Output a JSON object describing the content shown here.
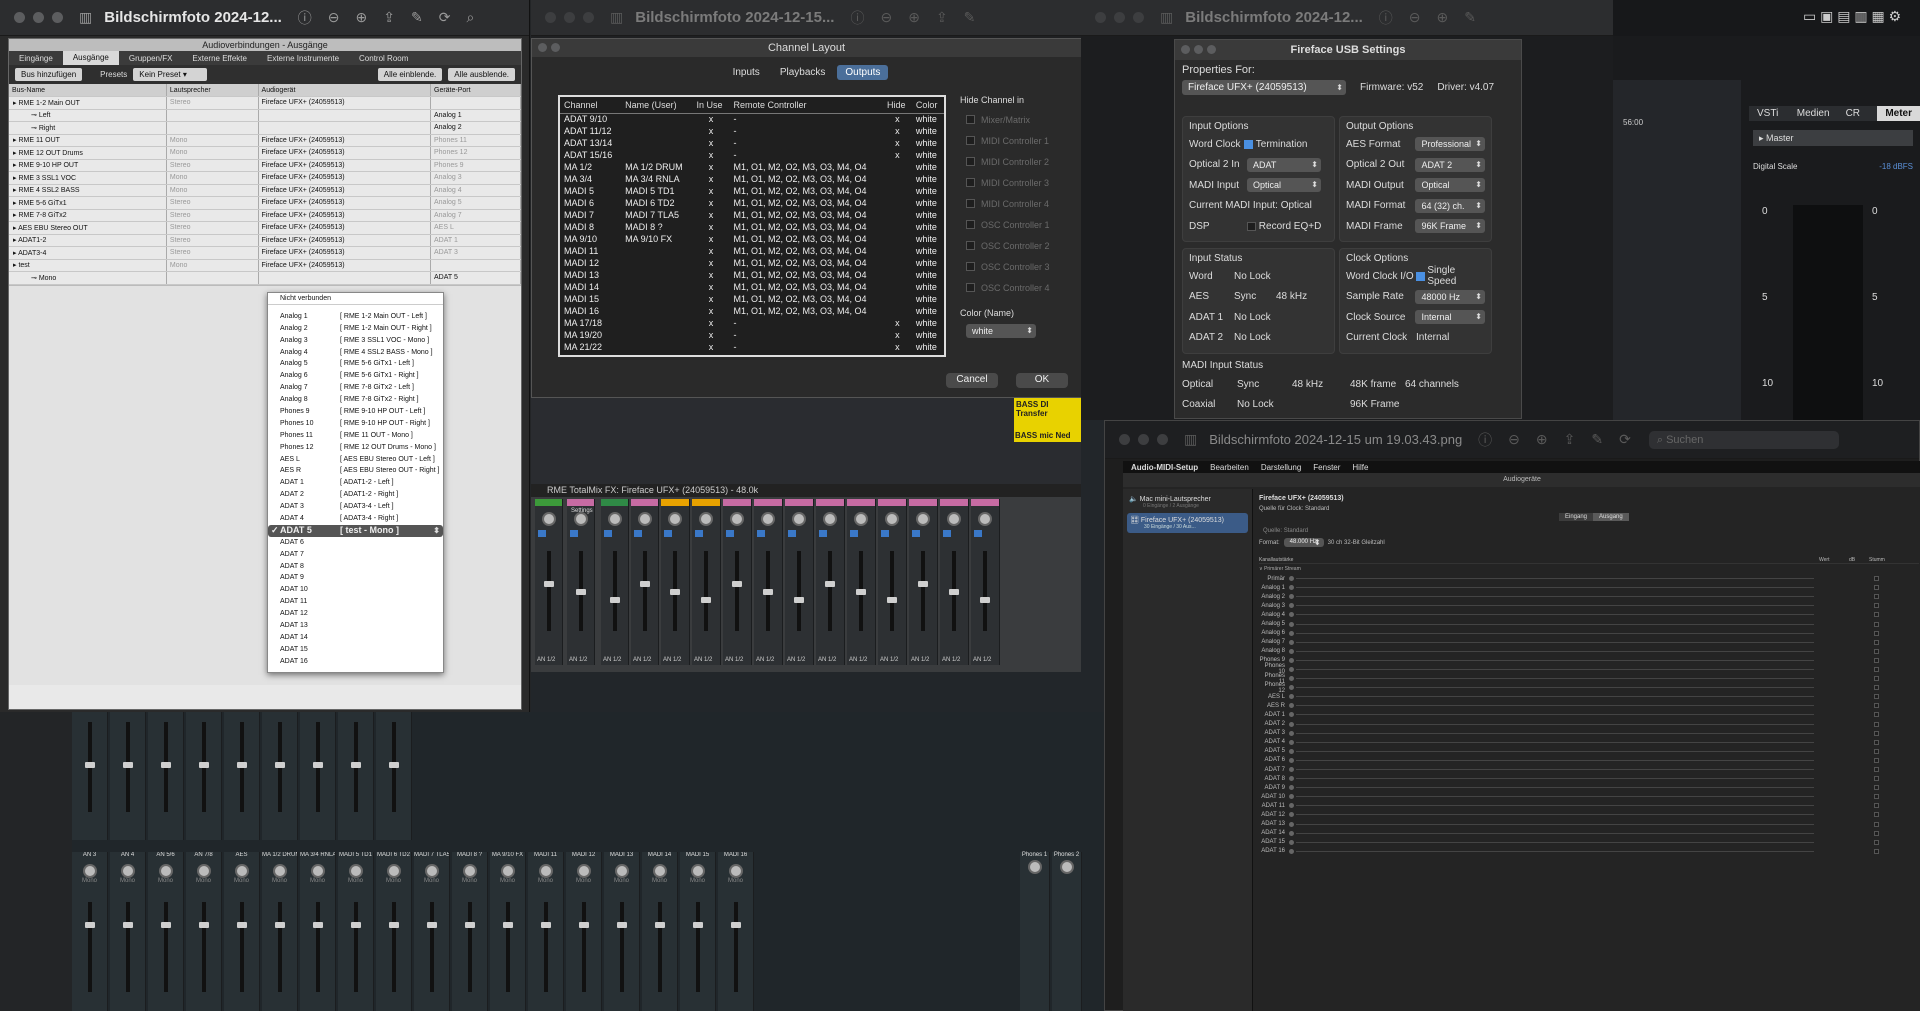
{
  "win1": {
    "title": "Bildschirmfoto 2024-12..."
  },
  "win2": {
    "title": "Bildschirmfoto 2024-12-15..."
  },
  "win3": {
    "title": "Bildschirmfoto 2024-12..."
  },
  "cubase": {
    "title": "Audioverbindungen - Ausgänge",
    "tabs": [
      "Eingänge",
      "Ausgänge",
      "Gruppen/FX",
      "Externe Effekte",
      "Externe Instrumente",
      "Control Room"
    ],
    "add_bus": "Bus hinzufügen",
    "presets_label": "Presets",
    "preset_value": "Kein Preset",
    "show_all": "Alle einblende.",
    "hide_all": "Alle ausblende.",
    "columns": [
      "Bus-Name",
      "Lautsprecher",
      "Audiogerät",
      "Geräte-Port"
    ],
    "rows": [
      {
        "name": "RME 1-2 Main OUT",
        "spk": "Stereo",
        "dev": "Fireface UFX+ (24059513)",
        "port": ""
      },
      {
        "name": "Left",
        "spk": "",
        "dev": "",
        "port": "Analog 1"
      },
      {
        "name": "Right",
        "spk": "",
        "dev": "",
        "port": "Analog 2"
      },
      {
        "name": "RME 11 OUT",
        "spk": "Mono",
        "dev": "Fireface UFX+ (24059513)",
        "port": "Phones 11"
      },
      {
        "name": "RME 12 OUT Drums",
        "spk": "Mono",
        "dev": "Fireface UFX+ (24059513)",
        "port": "Phones 12"
      },
      {
        "name": "RME 9-10 HP OUT",
        "spk": "Stereo",
        "dev": "Fireface UFX+ (24059513)",
        "port": "Phones 9"
      },
      {
        "name": "RME 3 SSL1 VOC",
        "spk": "Mono",
        "dev": "Fireface UFX+ (24059513)",
        "port": "Analog 3"
      },
      {
        "name": "RME 4 SSL2 BASS",
        "spk": "Mono",
        "dev": "Fireface UFX+ (24059513)",
        "port": "Analog 4"
      },
      {
        "name": "RME 5-6 GiTx1",
        "spk": "Stereo",
        "dev": "Fireface UFX+ (24059513)",
        "port": "Analog 5"
      },
      {
        "name": "RME 7-8 GiTx2",
        "spk": "Stereo",
        "dev": "Fireface UFX+ (24059513)",
        "port": "Analog 7"
      },
      {
        "name": "AES EBU Stereo OUT",
        "spk": "Stereo",
        "dev": "Fireface UFX+ (24059513)",
        "port": "AES L"
      },
      {
        "name": "ADAT1-2",
        "spk": "Stereo",
        "dev": "Fireface UFX+ (24059513)",
        "port": "ADAT 1"
      },
      {
        "name": "ADAT3-4",
        "spk": "Stereo",
        "dev": "Fireface UFX+ (24059513)",
        "port": "ADAT 3"
      },
      {
        "name": "test",
        "spk": "Mono",
        "dev": "Fireface UFX+ (24059513)",
        "port": ""
      },
      {
        "name": "Mono",
        "spk": "",
        "dev": "",
        "port": "ADAT 5"
      }
    ],
    "dropdown": {
      "not_connected": "Nicht verbunden",
      "items": [
        [
          "Analog 1",
          "[ RME 1-2 Main OUT - Left ]"
        ],
        [
          "Analog 2",
          "[ RME 1-2 Main OUT - Right ]"
        ],
        [
          "Analog 3",
          "[ RME 3 SSL1 VOC - Mono ]"
        ],
        [
          "Analog 4",
          "[ RME 4 SSL2 BASS - Mono ]"
        ],
        [
          "Analog 5",
          "[ RME 5-6 GiTx1 - Left ]"
        ],
        [
          "Analog 6",
          "[ RME 5-6 GiTx1 - Right ]"
        ],
        [
          "Analog 7",
          "[ RME 7-8 GiTx2 - Left ]"
        ],
        [
          "Analog 8",
          "[ RME 7-8 GiTx2 - Right ]"
        ],
        [
          "Phones 9",
          "[ RME 9-10 HP OUT - Left ]"
        ],
        [
          "Phones 10",
          "[ RME 9-10 HP OUT - Right ]"
        ],
        [
          "Phones 11",
          "[ RME 11 OUT - Mono ]"
        ],
        [
          "Phones 12",
          "[ RME 12 OUT Drums - Mono ]"
        ],
        [
          "AES L",
          "[ AES EBU Stereo OUT - Left ]"
        ],
        [
          "AES R",
          "[ AES EBU Stereo OUT - Right ]"
        ],
        [
          "ADAT 1",
          "[ ADAT1-2 - Left ]"
        ],
        [
          "ADAT 2",
          "[ ADAT1-2 - Right ]"
        ],
        [
          "ADAT 3",
          "[ ADAT3-4 - Left ]"
        ],
        [
          "ADAT 4",
          "[ ADAT3-4 - Right ]"
        ],
        [
          "ADAT 5",
          "[ test - Mono ]"
        ],
        [
          "ADAT 6",
          ""
        ],
        [
          "ADAT 7",
          ""
        ],
        [
          "ADAT 8",
          ""
        ],
        [
          "ADAT 9",
          ""
        ],
        [
          "ADAT 10",
          ""
        ],
        [
          "ADAT 11",
          ""
        ],
        [
          "ADAT 12",
          ""
        ],
        [
          "ADAT 13",
          ""
        ],
        [
          "ADAT 14",
          ""
        ],
        [
          "ADAT 15",
          ""
        ],
        [
          "ADAT 16",
          ""
        ]
      ],
      "selected_index": 18
    }
  },
  "channel_layout": {
    "title": "Channel Layout",
    "tabs": [
      "Inputs",
      "Playbacks",
      "Outputs"
    ],
    "active_tab": 2,
    "columns": [
      "Channel",
      "Name (User)",
      "In Use",
      "Remote Controller",
      "Hide",
      "Color"
    ],
    "rows": [
      [
        "ADAT 9/10",
        "",
        "x",
        "-",
        "x",
        "white"
      ],
      [
        "ADAT 11/12",
        "",
        "x",
        "-",
        "x",
        "white"
      ],
      [
        "ADAT 13/14",
        "",
        "x",
        "-",
        "x",
        "white"
      ],
      [
        "ADAT 15/16",
        "",
        "x",
        "-",
        "x",
        "white"
      ],
      [
        "MA 1/2",
        "MA 1/2 DRUM",
        "x",
        "M1, O1, M2, O2, M3, O3, M4, O4",
        "",
        "white"
      ],
      [
        "MA 3/4",
        "MA 3/4 RNLA",
        "x",
        "M1, O1, M2, O2, M3, O3, M4, O4",
        "",
        "white"
      ],
      [
        "MADI 5",
        "MADI 5 TD1",
        "x",
        "M1, O1, M2, O2, M3, O3, M4, O4",
        "",
        "white"
      ],
      [
        "MADI 6",
        "MADI 6 TD2",
        "x",
        "M1, O1, M2, O2, M3, O3, M4, O4",
        "",
        "white"
      ],
      [
        "MADI 7",
        "MADI 7 TLA5",
        "x",
        "M1, O1, M2, O2, M3, O3, M4, O4",
        "",
        "white"
      ],
      [
        "MADI 8",
        "MADI 8 ?",
        "x",
        "M1, O1, M2, O2, M3, O3, M4, O4",
        "",
        "white"
      ],
      [
        "MA 9/10",
        "MA 9/10 FX",
        "x",
        "M1, O1, M2, O2, M3, O3, M4, O4",
        "",
        "white"
      ],
      [
        "MADI 11",
        "",
        "x",
        "M1, O1, M2, O2, M3, O3, M4, O4",
        "",
        "white"
      ],
      [
        "MADI 12",
        "",
        "x",
        "M1, O1, M2, O2, M3, O3, M4, O4",
        "",
        "white"
      ],
      [
        "MADI 13",
        "",
        "x",
        "M1, O1, M2, O2, M3, O3, M4, O4",
        "",
        "white"
      ],
      [
        "MADI 14",
        "",
        "x",
        "M1, O1, M2, O2, M3, O3, M4, O4",
        "",
        "white"
      ],
      [
        "MADI 15",
        "",
        "x",
        "M1, O1, M2, O2, M3, O3, M4, O4",
        "",
        "white"
      ],
      [
        "MADI 16",
        "",
        "x",
        "M1, O1, M2, O2, M3, O3, M4, O4",
        "",
        "white"
      ],
      [
        "MA 17/18",
        "",
        "x",
        "-",
        "x",
        "white"
      ],
      [
        "MA 19/20",
        "",
        "x",
        "-",
        "x",
        "white"
      ],
      [
        "MA 21/22",
        "",
        "x",
        "-",
        "x",
        "white"
      ]
    ],
    "hide_heading": "Hide Channel in",
    "hide_items": [
      "Mixer/Matrix",
      "MIDI Controller 1",
      "MIDI Controller 2",
      "MIDI Controller 3",
      "MIDI Controller 4",
      "OSC Controller 1",
      "OSC Controller 2",
      "OSC Controller 3",
      "OSC Controller 4"
    ],
    "color_label": "Color (Name)",
    "color_value": "white",
    "cancel": "Cancel",
    "ok": "OK"
  },
  "fireface": {
    "title": "Fireface USB Settings",
    "properties_for": "Properties For:",
    "device": "Fireface UFX+ (24059513)",
    "firmware": "Firmware: v52",
    "driver": "Driver: v4.07",
    "input_options": "Input Options",
    "output_options": "Output Options",
    "word_clock": "Word Clock",
    "termination": "Termination",
    "optical2in": "Optical 2 In",
    "optical2in_v": "ADAT",
    "madi_input": "MADI Input",
    "madi_input_v": "Optical",
    "cur_madi": "Current MADI Input:",
    "cur_madi_v": "Optical",
    "dsp": "DSP",
    "record_eqd": "Record EQ+D",
    "aes_format": "AES Format",
    "aes_format_v": "Professional",
    "optical2out": "Optical 2 Out",
    "optical2out_v": "ADAT 2",
    "madi_output": "MADI Output",
    "madi_output_v": "Optical",
    "madi_format": "MADI Format",
    "madi_format_v": "64 (32) ch.",
    "madi_frame": "MADI Frame",
    "madi_frame_v": "96K Frame",
    "input_status": "Input Status",
    "clock_options": "Clock Options",
    "status": [
      [
        "Word",
        "No Lock",
        ""
      ],
      [
        "AES",
        "Sync",
        "48 kHz"
      ],
      [
        "ADAT 1",
        "No Lock",
        ""
      ],
      [
        "ADAT 2",
        "No Lock",
        ""
      ]
    ],
    "wc_io": "Word Clock I/O",
    "single_speed": "Single Speed",
    "sample_rate": "Sample Rate",
    "sample_rate_v": "48000 Hz",
    "clock_source": "Clock Source",
    "clock_source_v": "Internal",
    "current_clock": "Current Clock",
    "current_clock_v": "Internal",
    "madi_status": "MADI Input Status",
    "madi_rows": [
      [
        "Optical",
        "Sync",
        "48 kHz",
        "48K frame",
        "64 channels"
      ],
      [
        "Coaxial",
        "No Lock",
        "",
        "96K Frame",
        ""
      ]
    ]
  },
  "totalmix": {
    "title": "RME TotalMix FX: Fireface UFX+ (24059513) - 48.0k",
    "settings": "Settings",
    "channel_label": "AN 1/2",
    "bottom_names": [
      "AN 3",
      "AN 4",
      "AN 5/6",
      "AN 7/8",
      "AES",
      "MA 1/2 DRUM",
      "MA 3/4 RNLA",
      "MADI 5 TD1",
      "MADI 6 TD2",
      "MADI 7 TLA5",
      "MADI 8 ?",
      "MA 9/10 FX",
      "MADI 11",
      "MADI 12",
      "MADI 13",
      "MADI 14",
      "MADI 15",
      "MADI 16"
    ],
    "phones": [
      "Phones 1",
      "Phones 2"
    ],
    "mono": "Mono",
    "bass_di": "BASS DI Transfer",
    "bass_mic": "BASS mic Ned"
  },
  "cubase_right": {
    "tabs": [
      "VSTi",
      "Medien",
      "CR",
      "Meter"
    ],
    "master": "Master",
    "scale": "Digital Scale",
    "scale_v": "-18 dBFS",
    "ticks": [
      "0",
      "5",
      "10"
    ],
    "time": "56:00"
  },
  "midi": {
    "window_title": "Bildschirmfoto 2024-12-15 um 19.03.43.png",
    "search": "Suchen",
    "menu": [
      "Audio-MIDI-Setup",
      "Bearbeiten",
      "Darstellung",
      "Fenster",
      "Hilfe"
    ],
    "pane_title": "Audiogeräte",
    "dev1": "Mac mini-Lautsprecher",
    "dev1_sub": "0 Eingänge / 2 Ausgänge",
    "dev2": "Fireface UFX+ (24059513)",
    "dev2_sub": "30 Eingänge / 30 Aus...",
    "heading": "Fireface UFX+ (24059513)",
    "clock": "Quelle für Clock:",
    "clock_v": "Standard",
    "tab_in": "Eingang",
    "tab_out": "Ausgang",
    "source": "Quelle:",
    "source_v": "Standard",
    "format": "Format:",
    "format_v": "48.000 Hz",
    "format_bits": "30 ch 32-Bit Gleitzahl",
    "vol": "Kanallautstärke",
    "col_value": "Wert",
    "col_db": "dB",
    "col_mute": "Stumm",
    "stream": "Primärer Stream",
    "channels": [
      "Primär",
      "Analog 1",
      "Analog 2",
      "Analog 3",
      "Analog 4",
      "Analog 5",
      "Analog 6",
      "Analog 7",
      "Analog 8",
      "Phones 9",
      "Phones 10",
      "Phones 11",
      "Phones 12",
      "AES L",
      "AES R",
      "ADAT 1",
      "ADAT 2",
      "ADAT 3",
      "ADAT 4",
      "ADAT 5",
      "ADAT 6",
      "ADAT 7",
      "ADAT 8",
      "ADAT 9",
      "ADAT 10",
      "ADAT 11",
      "ADAT 12",
      "ADAT 13",
      "ADAT 14",
      "ADAT 15",
      "ADAT 16"
    ]
  }
}
